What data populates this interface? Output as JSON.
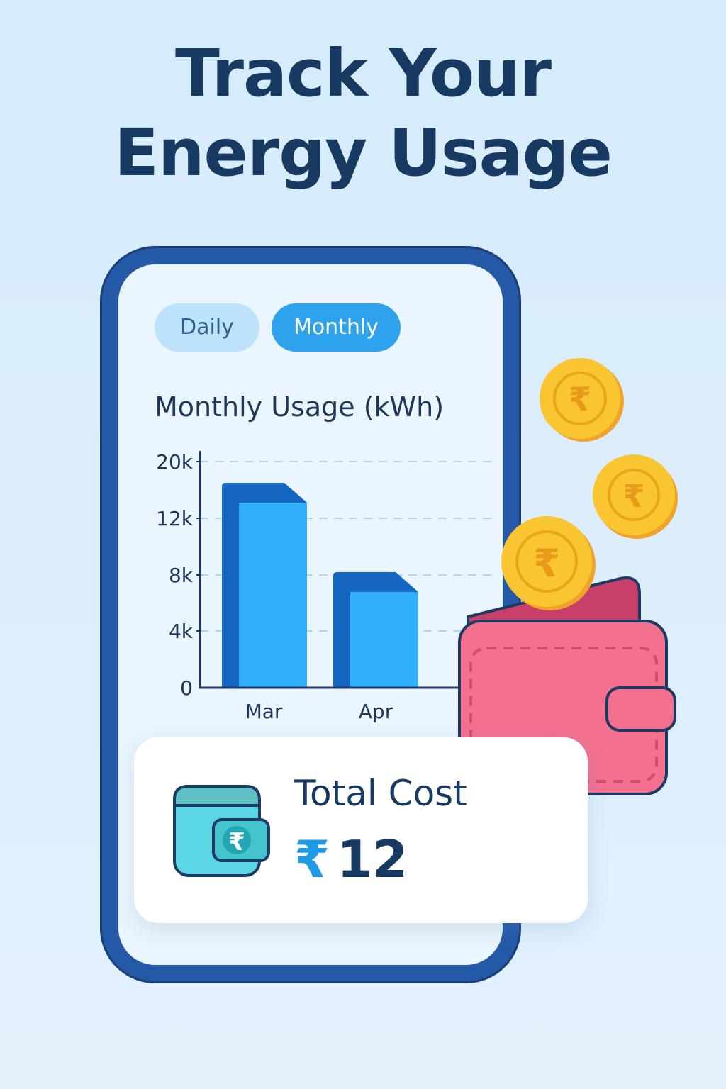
{
  "headline": {
    "line1": "Track Your",
    "line2": "Energy Usage"
  },
  "tabs": [
    {
      "label": "Daily",
      "selected": false
    },
    {
      "label": "Monthly",
      "selected": true
    }
  ],
  "chart_title": "Monthly Usage (kWh)",
  "chart_data": {
    "type": "bar",
    "title": "Monthly Usage (kWh)",
    "categories": [
      "Mar",
      "Apr"
    ],
    "values": [
      17000,
      8200
    ],
    "y_ticks": [
      "0",
      "4k",
      "8k",
      "12k",
      "20k"
    ],
    "xlabel": "",
    "ylabel": "",
    "grid": "dashed horizontal",
    "bar_color": "#33b0fb",
    "bar_shade_color": "#1466c2"
  },
  "cost_card": {
    "label": "Total Cost",
    "currency": "₹",
    "amount": "12"
  },
  "icons": {
    "coin": "rupee-coin-icon",
    "wallet": "wallet-icon",
    "card_wallet": "rupee-wallet-icon"
  },
  "colors": {
    "background": "#d6ecfb",
    "phone_frame": "#2459a8",
    "headline": "#173a63",
    "accent": "#2ea2ec",
    "coin": "#f9c22e",
    "wallet": "#f47191"
  }
}
